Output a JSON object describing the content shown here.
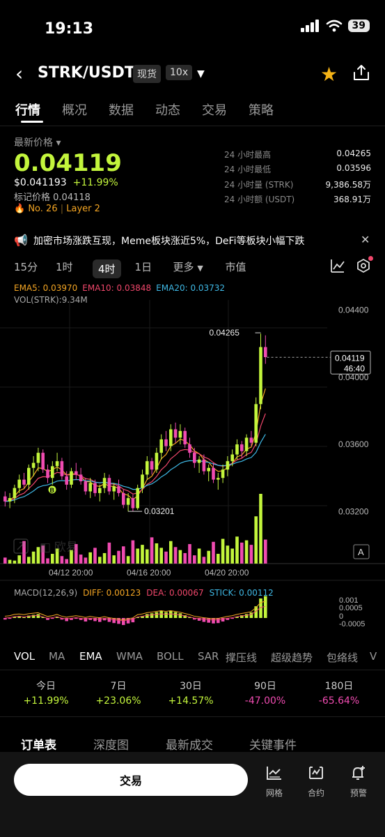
{
  "status": {
    "time": "19:13",
    "battery": "39"
  },
  "header": {
    "pair": "STRK/USDT",
    "tag_spot": "现货",
    "tag_leverage": "10x"
  },
  "tabs": [
    "行情",
    "概况",
    "数据",
    "动态",
    "交易",
    "策略"
  ],
  "price": {
    "label": "最新价格",
    "last": "0.04119",
    "usd": "$0.041193",
    "change": "+11.99%",
    "mark_label": "标记价格",
    "mark_value": "0.04118",
    "rank": "No. 26",
    "category": "Layer 2"
  },
  "stats": [
    {
      "label": "24 小时最高",
      "value": "0.04265"
    },
    {
      "label": "24 小时最低",
      "value": "0.03596"
    },
    {
      "label": "24 小时量 (STRK)",
      "value": "9,386.58万"
    },
    {
      "label": "24 小时额 (USDT)",
      "value": "368.91万"
    }
  ],
  "news": {
    "text": "加密市场涨跌互现，Meme板块涨近5%，DeFi等板块小幅下跌"
  },
  "intervals": {
    "items": [
      "15分",
      "1时",
      "4时",
      "1日",
      "更多",
      "市值"
    ],
    "active": "4时"
  },
  "legend": {
    "ema5": "EMA5: 0.03970",
    "ema10": "EMA10: 0.03848",
    "ema20": "EMA20: 0.03732",
    "vol": "VOL(STRK):9.34M",
    "macd_name": "MACD(12,26,9)",
    "diff": "DIFF: 0.00123",
    "dea": "DEA: 0.00067",
    "stick": "STICK: 0.00112"
  },
  "colors": {
    "up": "#c3f53c",
    "down": "#f04bb1",
    "ema5": "#f5a623",
    "ema10": "#f0476b",
    "ema20": "#3fb9e6"
  },
  "chart_data": {
    "type": "candlestick",
    "interval": "4时",
    "price_axis": [
      "0.04400",
      "0.04000",
      "0.03600",
      "0.03200"
    ],
    "time_axis": [
      "04/12 20:00",
      "04/16 20:00",
      "04/20 20:00"
    ],
    "max_label": "0.04265",
    "min_label": "0.03201",
    "current_price": "0.04119",
    "countdown": "46:40",
    "macd_axis": [
      "0.001",
      "0.0005",
      "0",
      "-0.0005"
    ],
    "ylim": [
      0.0311,
      0.0449
    ],
    "candles": [
      [
        0.0329,
        0.0332,
        0.0323,
        0.0326
      ],
      [
        0.0326,
        0.0331,
        0.0322,
        0.0328
      ],
      [
        0.0328,
        0.0336,
        0.0325,
        0.0334
      ],
      [
        0.0334,
        0.0342,
        0.0331,
        0.0339
      ],
      [
        0.0339,
        0.0343,
        0.0334,
        0.0336
      ],
      [
        0.0336,
        0.0348,
        0.0333,
        0.0346
      ],
      [
        0.0346,
        0.0353,
        0.0341,
        0.0349
      ],
      [
        0.0349,
        0.0358,
        0.0344,
        0.0355
      ],
      [
        0.0355,
        0.0357,
        0.0343,
        0.0345
      ],
      [
        0.0345,
        0.0348,
        0.0337,
        0.034
      ],
      [
        0.034,
        0.035,
        0.0336,
        0.0347
      ],
      [
        0.0347,
        0.0355,
        0.0344,
        0.035
      ],
      [
        0.035,
        0.0352,
        0.0339,
        0.0341
      ],
      [
        0.0341,
        0.0344,
        0.0333,
        0.0336
      ],
      [
        0.0336,
        0.0346,
        0.0334,
        0.0344
      ],
      [
        0.0344,
        0.0349,
        0.0339,
        0.0342
      ],
      [
        0.0342,
        0.0346,
        0.0336,
        0.0338
      ],
      [
        0.0338,
        0.034,
        0.033,
        0.0332
      ],
      [
        0.0332,
        0.034,
        0.0328,
        0.0337
      ],
      [
        0.0337,
        0.0339,
        0.0329,
        0.0331
      ],
      [
        0.0331,
        0.0336,
        0.0326,
        0.0334
      ],
      [
        0.0334,
        0.0343,
        0.0331,
        0.034
      ],
      [
        0.034,
        0.0342,
        0.033,
        0.0332
      ],
      [
        0.0332,
        0.0337,
        0.0327,
        0.0335
      ],
      [
        0.0335,
        0.0339,
        0.0329,
        0.0331
      ],
      [
        0.0331,
        0.0333,
        0.0322,
        0.0324
      ],
      [
        0.0324,
        0.0331,
        0.032,
        0.0328
      ],
      [
        0.0328,
        0.033,
        0.032,
        0.0322
      ],
      [
        0.0322,
        0.0336,
        0.0321,
        0.0334
      ],
      [
        0.0334,
        0.0345,
        0.0331,
        0.0342
      ],
      [
        0.0342,
        0.0353,
        0.0339,
        0.035
      ],
      [
        0.035,
        0.0352,
        0.0342,
        0.0345
      ],
      [
        0.0345,
        0.0358,
        0.0343,
        0.0355
      ],
      [
        0.0355,
        0.0366,
        0.0351,
        0.0363
      ],
      [
        0.0363,
        0.0368,
        0.0356,
        0.0359
      ],
      [
        0.0359,
        0.0372,
        0.0356,
        0.0369
      ],
      [
        0.0369,
        0.0373,
        0.0361,
        0.0364
      ],
      [
        0.0364,
        0.0372,
        0.036,
        0.0368
      ],
      [
        0.0368,
        0.037,
        0.0358,
        0.036
      ],
      [
        0.036,
        0.0364,
        0.0352,
        0.0355
      ],
      [
        0.0355,
        0.0358,
        0.0346,
        0.0349
      ],
      [
        0.0349,
        0.0353,
        0.0343,
        0.0351
      ],
      [
        0.0351,
        0.0354,
        0.0342,
        0.0344
      ],
      [
        0.0344,
        0.0348,
        0.0338,
        0.0346
      ],
      [
        0.0346,
        0.0349,
        0.0337,
        0.0339
      ],
      [
        0.0339,
        0.0343,
        0.0333,
        0.034
      ],
      [
        0.034,
        0.0348,
        0.0337,
        0.0345
      ],
      [
        0.0345,
        0.0353,
        0.0341,
        0.035
      ],
      [
        0.035,
        0.0357,
        0.0347,
        0.0354
      ],
      [
        0.0354,
        0.0363,
        0.0351,
        0.036
      ],
      [
        0.036,
        0.0362,
        0.0352,
        0.0356
      ],
      [
        0.0356,
        0.0366,
        0.0353,
        0.0364
      ],
      [
        0.0364,
        0.0368,
        0.0359,
        0.0361
      ],
      [
        0.0361,
        0.0388,
        0.0359,
        0.0384
      ],
      [
        0.0384,
        0.0426,
        0.0381,
        0.0418
      ],
      [
        0.0418,
        0.0425,
        0.0408,
        0.0412
      ]
    ],
    "volumes": [
      0.8,
      0.5,
      0.4,
      1.1,
      3.0,
      0.9,
      1.6,
      2.2,
      2.4,
      0.7,
      1.3,
      2.0,
      1.0,
      0.6,
      1.8,
      2.6,
      1.2,
      0.8,
      1.5,
      2.1,
      0.9,
      1.4,
      2.8,
      1.1,
      1.7,
      2.3,
      1.0,
      3.1,
      2.0,
      2.5,
      1.9,
      3.5,
      2.7,
      2.1,
      1.6,
      3.0,
      2.2,
      1.8,
      1.4,
      2.6,
      1.1,
      2.0,
      0.9,
      1.7,
      2.9,
      1.3,
      3.3,
      2.4,
      2.0,
      3.6,
      2.8,
      3.1,
      2.5,
      6.3,
      9.3,
      3.2
    ],
    "macd": [
      -8e-05,
      -4e-05,
      6e-05,
      0.0001,
      4e-05,
      0.00012,
      0.00016,
      0.0002,
      5e-05,
      -0.0001,
      -4e-05,
      6e-05,
      -8e-05,
      -0.00016,
      -0.0001,
      -4e-05,
      -0.0001,
      -0.00018,
      -0.0001,
      -0.00016,
      -0.0002,
      -0.00012,
      -0.0002,
      -0.00026,
      -0.0003,
      -0.00036,
      -0.00028,
      -0.00022,
      4e-05,
      0.0001,
      0.0002,
      0.00024,
      0.0003,
      0.00036,
      0.0003,
      0.00036,
      0.0003,
      0.00024,
      0.00014,
      4e-05,
      -8e-05,
      -0.00014,
      -0.0002,
      -0.00024,
      -0.00028,
      -0.00026,
      -0.00018,
      -0.0001,
      -4e-05,
      6e-05,
      0.00014,
      0.0002,
      0.00028,
      0.0006,
      0.001,
      0.00112
    ]
  },
  "indicator_tabs": {
    "items": [
      "VOL",
      "MA",
      "EMA",
      "WMA",
      "BOLL",
      "SAR",
      "撑压线",
      "超级趋势",
      "包络线",
      "V"
    ],
    "active": [
      "VOL",
      "EMA"
    ]
  },
  "performance": [
    {
      "label": "今日",
      "value": "+11.99%",
      "dir": "up"
    },
    {
      "label": "7日",
      "value": "+23.06%",
      "dir": "up"
    },
    {
      "label": "30日",
      "value": "+14.57%",
      "dir": "up"
    },
    {
      "label": "90日",
      "value": "-47.00%",
      "dir": "down"
    },
    {
      "label": "180日",
      "value": "-65.64%",
      "dir": "down"
    }
  ],
  "order_tabs": [
    "订单表",
    "深度图",
    "最新成交",
    "关键事件"
  ],
  "bottom": {
    "trade": "交易",
    "grid": "网格",
    "contract": "合约",
    "alert": "预警"
  }
}
